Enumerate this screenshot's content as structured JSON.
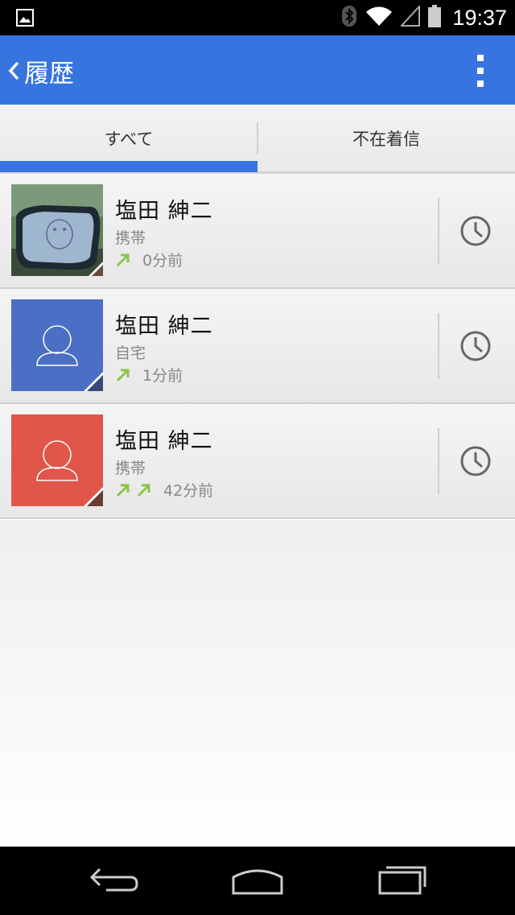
{
  "status": {
    "time": "19:37",
    "icons": [
      "image-notification-icon",
      "bluetooth-icon",
      "wifi-icon",
      "cell-signal-icon",
      "battery-icon"
    ]
  },
  "app_bar": {
    "title": "履歴",
    "color": "#3874e0"
  },
  "tabs": [
    {
      "label": "すべて",
      "selected": true
    },
    {
      "label": "不在着信",
      "selected": false
    }
  ],
  "calls": [
    {
      "name": "塩田 紳二",
      "type": "携帯",
      "time_ago": "0分前",
      "arrow_count": 1,
      "avatar": "photo"
    },
    {
      "name": "塩田 紳二",
      "type": "自宅",
      "time_ago": "1分前",
      "arrow_count": 1,
      "avatar": "placeholder",
      "avatar_color": "#4a6fc4"
    },
    {
      "name": "塩田 紳二",
      "type": "携帯",
      "time_ago": "42分前",
      "arrow_count": 2,
      "avatar": "placeholder",
      "avatar_color": "#e0564a"
    }
  ],
  "colors": {
    "accent": "#3874e0",
    "outgoing_arrow": "#8bc34a"
  },
  "nav": [
    "back-icon",
    "home-icon",
    "recents-icon"
  ]
}
